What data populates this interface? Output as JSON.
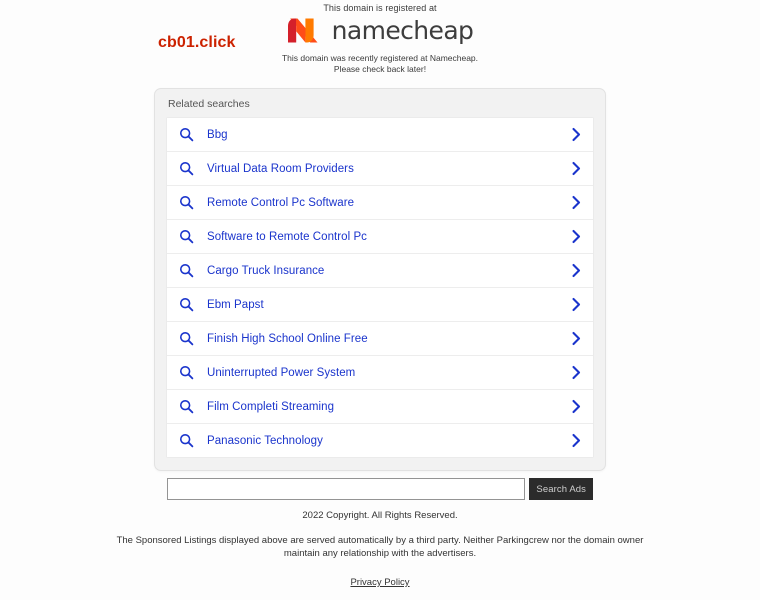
{
  "header": {
    "registered_at_text": "This domain is registered at",
    "brand_name": "namecheap",
    "brand_logo_icon": "namecheap-n-mark",
    "brand_color": "#ff4d18",
    "notice_line1": "This domain was recently registered at Namecheap.",
    "notice_line2": "Please check back later!",
    "domain": "cb01.click",
    "domain_color": "#cc2200"
  },
  "panel": {
    "title": "Related searches",
    "link_color": "#1a34cc",
    "rows": [
      {
        "label": "Bbg",
        "search_icon": "search-icon",
        "chevron_icon": "chevron-right-icon"
      },
      {
        "label": "Virtual Data Room Providers",
        "search_icon": "search-icon",
        "chevron_icon": "chevron-right-icon"
      },
      {
        "label": "Remote Control Pc Software",
        "search_icon": "search-icon",
        "chevron_icon": "chevron-right-icon"
      },
      {
        "label": "Software to Remote Control Pc",
        "search_icon": "search-icon",
        "chevron_icon": "chevron-right-icon"
      },
      {
        "label": "Cargo Truck Insurance",
        "search_icon": "search-icon",
        "chevron_icon": "chevron-right-icon"
      },
      {
        "label": "Ebm Papst",
        "search_icon": "search-icon",
        "chevron_icon": "chevron-right-icon"
      },
      {
        "label": "Finish High School Online Free",
        "search_icon": "search-icon",
        "chevron_icon": "chevron-right-icon"
      },
      {
        "label": "Uninterrupted Power System",
        "search_icon": "search-icon",
        "chevron_icon": "chevron-right-icon"
      },
      {
        "label": "Film Completi Streaming",
        "search_icon": "search-icon",
        "chevron_icon": "chevron-right-icon"
      },
      {
        "label": "Panasonic Technology",
        "search_icon": "search-icon",
        "chevron_icon": "chevron-right-icon"
      }
    ]
  },
  "search": {
    "value": "",
    "placeholder": "",
    "button_label": "Search Ads"
  },
  "footer": {
    "copyright": "2022 Copyright. All Rights Reserved.",
    "disclaimer": "The Sponsored Listings displayed above are served automatically by a third party. Neither Parkingcrew nor the domain owner maintain any relationship with the advertisers.",
    "privacy_label": "Privacy Policy"
  }
}
